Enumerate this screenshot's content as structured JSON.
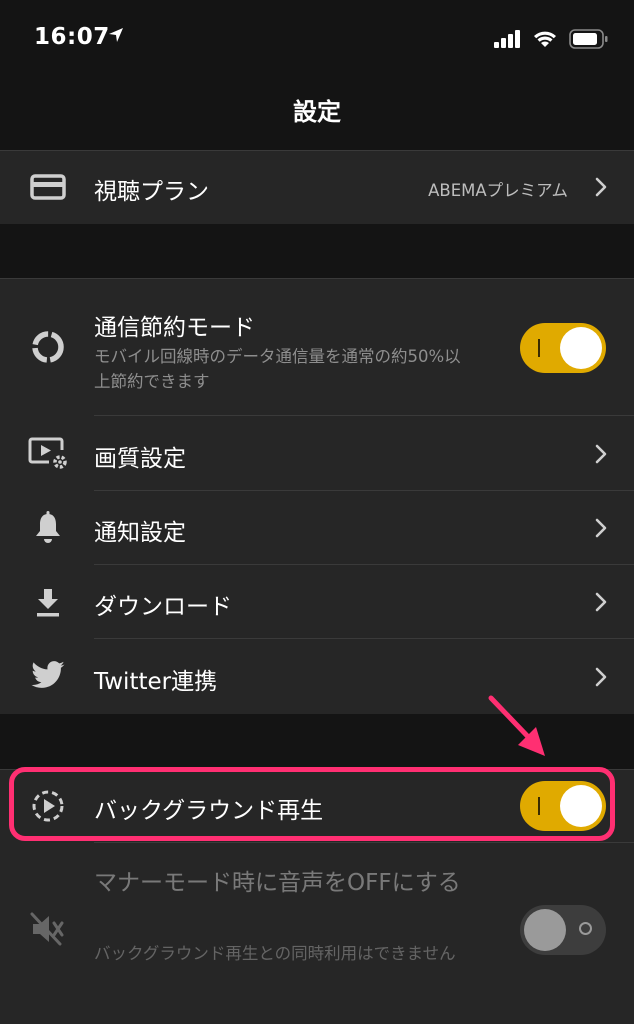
{
  "status_bar": {
    "time": "16:07"
  },
  "nav": {
    "title": "設定"
  },
  "plan": {
    "label": "視聴プラン",
    "value": "ABEMAプレミアム"
  },
  "settings": {
    "data_saver": {
      "label": "通信節約モード",
      "description": "モバイル回線時のデータ通信量を通常の約50%以上節約できます",
      "enabled": true
    },
    "quality": {
      "label": "画質設定"
    },
    "notification": {
      "label": "通知設定"
    },
    "download": {
      "label": "ダウンロード"
    },
    "twitter": {
      "label": "Twitter連携"
    }
  },
  "playback": {
    "background": {
      "label": "バックグラウンド再生",
      "enabled": true
    },
    "manner_mode": {
      "label": "マナーモード時に音声をOFFにする",
      "description": "バックグラウンド再生との同時利用はできません",
      "enabled": false
    }
  },
  "colors": {
    "accent": "#e0aa00",
    "highlight": "#ff2f72",
    "background": "#141414",
    "cell": "#262626"
  },
  "icons": {
    "plan": "credit-card-icon",
    "data_saver": "circle-spinner-icon",
    "quality": "video-settings-icon",
    "notification": "bell-icon",
    "download": "download-icon",
    "twitter": "twitter-bird-icon",
    "background": "dashed-play-icon",
    "manner_mode": "mute-icon"
  }
}
